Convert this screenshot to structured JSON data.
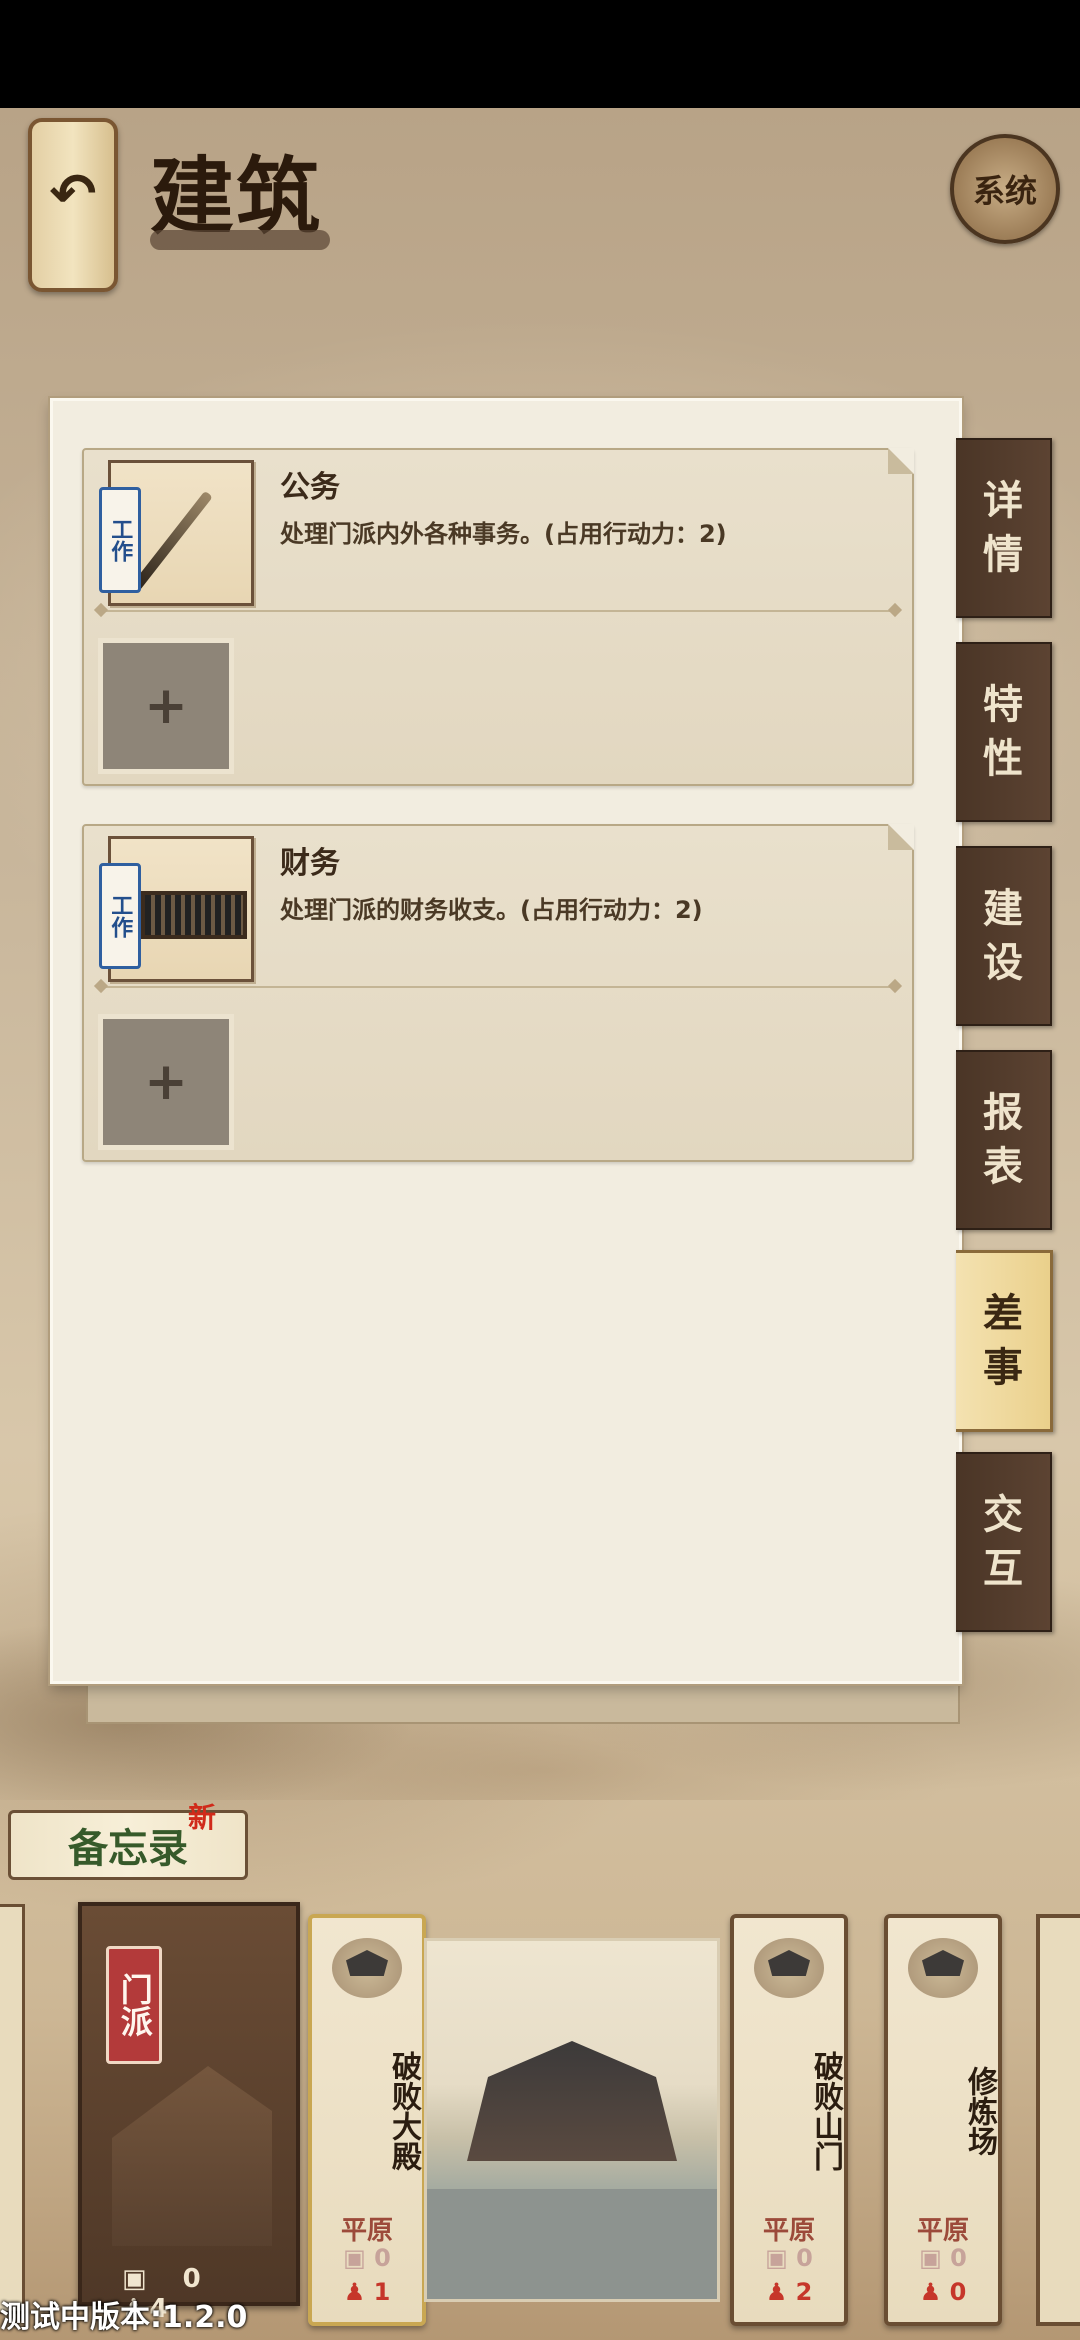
{
  "header": {
    "title": "建筑",
    "system_label": "系统"
  },
  "tasks": [
    {
      "tag": "工作",
      "title": "公务",
      "desc": "处理门派内外各种事务。(占用行动力：2)",
      "icon": "brush-icon",
      "add_label": "+"
    },
    {
      "tag": "工作",
      "title": "财务",
      "desc": "处理门派的财务收支。(占用行动力：2)",
      "icon": "abacus-icon",
      "add_label": "+"
    }
  ],
  "side_tabs": [
    {
      "label": "详\n情",
      "active": false
    },
    {
      "label": "特\n性",
      "active": false
    },
    {
      "label": "建\n设",
      "active": false
    },
    {
      "label": "报\n表",
      "active": false
    },
    {
      "label": "差\n事",
      "active": true
    },
    {
      "label": "交\n互",
      "active": false
    }
  ],
  "memo": {
    "label": "备忘录",
    "badge": "新"
  },
  "sect_card": {
    "tag": "门派",
    "scroll_count": "0",
    "people_count": "4"
  },
  "buildings": [
    {
      "name": "破败大殿",
      "terrain": "平原",
      "stat1": "0",
      "stat2": "1"
    },
    {
      "name": "破败山门",
      "terrain": "平原",
      "stat1": "0",
      "stat2": "2"
    },
    {
      "name": "修炼场",
      "terrain": "平原",
      "stat1": "0",
      "stat2": "0"
    }
  ],
  "version": "测试中版本:1.2.0"
}
